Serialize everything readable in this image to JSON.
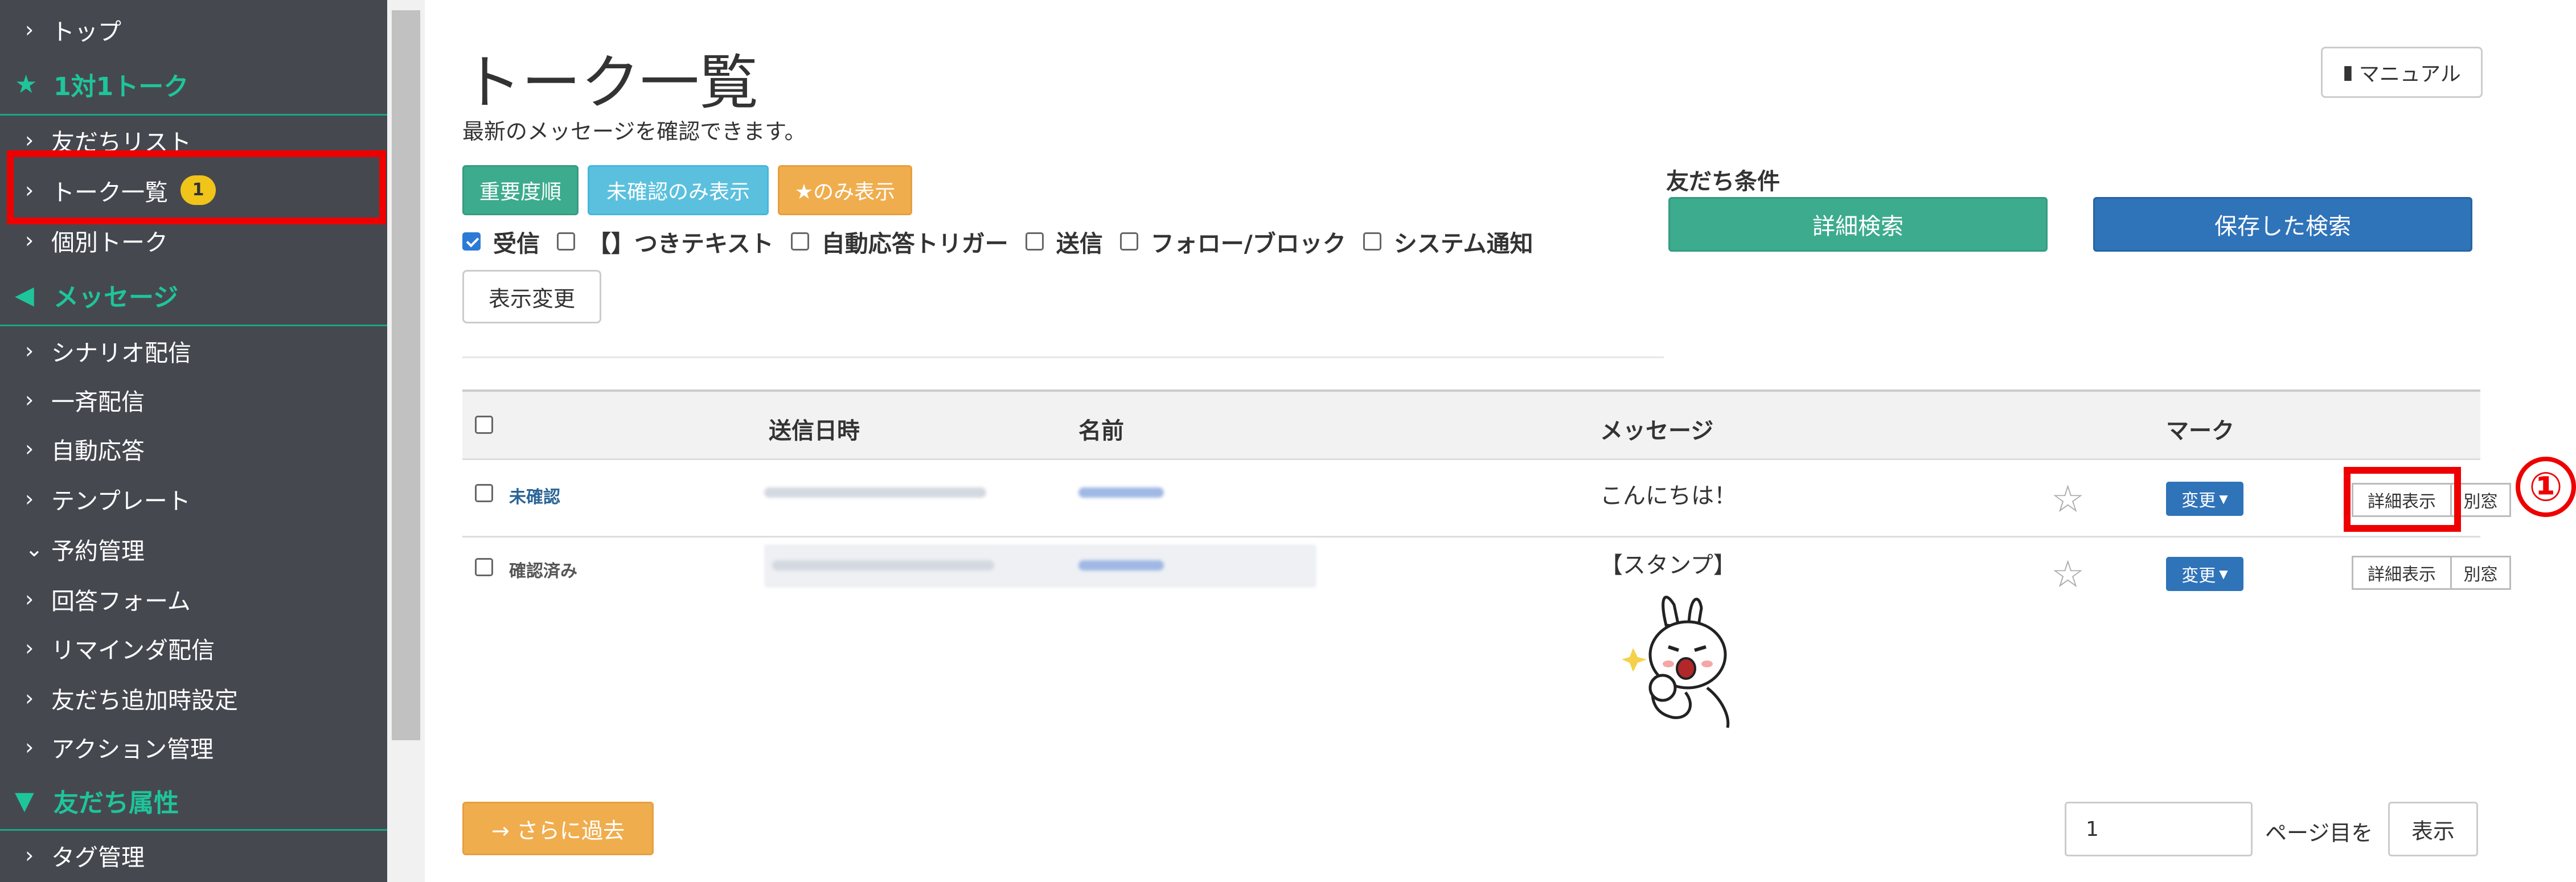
{
  "sidebar": {
    "items": [
      {
        "label": "トップ"
      },
      {
        "section": "1対1トーク"
      },
      {
        "label": "友だちリスト"
      },
      {
        "label": "トーク一覧",
        "badge": "1"
      },
      {
        "label": "個別トーク"
      },
      {
        "section": "メッセージ"
      },
      {
        "label": "シナリオ配信"
      },
      {
        "label": "一斉配信"
      },
      {
        "label": "自動応答"
      },
      {
        "label": "テンプレート"
      },
      {
        "label": "予約管理"
      },
      {
        "label": "回答フォーム"
      },
      {
        "label": "リマインダ配信"
      },
      {
        "label": "友だち追加時設定"
      },
      {
        "label": "アクション管理"
      },
      {
        "section": "友だち属性"
      },
      {
        "label": "タグ管理"
      }
    ]
  },
  "page": {
    "title": "トーク一覧",
    "subtitle": "最新のメッセージを確認できます。",
    "manual_label": "マニュアル"
  },
  "filters": {
    "buttons": [
      {
        "label": "重要度順",
        "color": "#3dab8e"
      },
      {
        "label": "未確認のみ表示",
        "color": "#5bc0de"
      },
      {
        "label": "★のみ表示",
        "color": "#f0ad4e"
      }
    ],
    "checkboxes": [
      {
        "label": "受信",
        "checked": true
      },
      {
        "label": "【】つきテキスト",
        "checked": false
      },
      {
        "label": "自動応答トリガー",
        "checked": false
      },
      {
        "label": "送信",
        "checked": false
      },
      {
        "label": "フォロー/ブロック",
        "checked": false
      },
      {
        "label": "システム通知",
        "checked": false
      }
    ],
    "display_change_label": "表示変更"
  },
  "friend_conditions": {
    "title": "友だち条件",
    "detail_search": "詳細検索",
    "saved_search": "保存した検索"
  },
  "table": {
    "headers": {
      "sent_at": "送信日時",
      "name": "名前",
      "message": "メッセージ",
      "mark": "マーク"
    },
    "rows": [
      {
        "status": "未確認",
        "message": "こんにちは！",
        "change": "変更",
        "detail": "詳細表示",
        "new_window": "別窓"
      },
      {
        "status": "確認済み",
        "message": "【スタンプ】",
        "change": "変更",
        "detail": "詳細表示",
        "new_window": "別窓"
      }
    ]
  },
  "annotation": {
    "step": "①"
  },
  "pagination": {
    "more_label": "→ さらに過去",
    "page_value": "1",
    "page_suffix": "ページ目を",
    "show_label": "表示"
  },
  "colors": {
    "sidebar_bg": "#464850",
    "section_accent": "#1ec59a",
    "highlight": "#ee0000",
    "primary_blue": "#2f73b9",
    "green": "#3dab8e"
  }
}
